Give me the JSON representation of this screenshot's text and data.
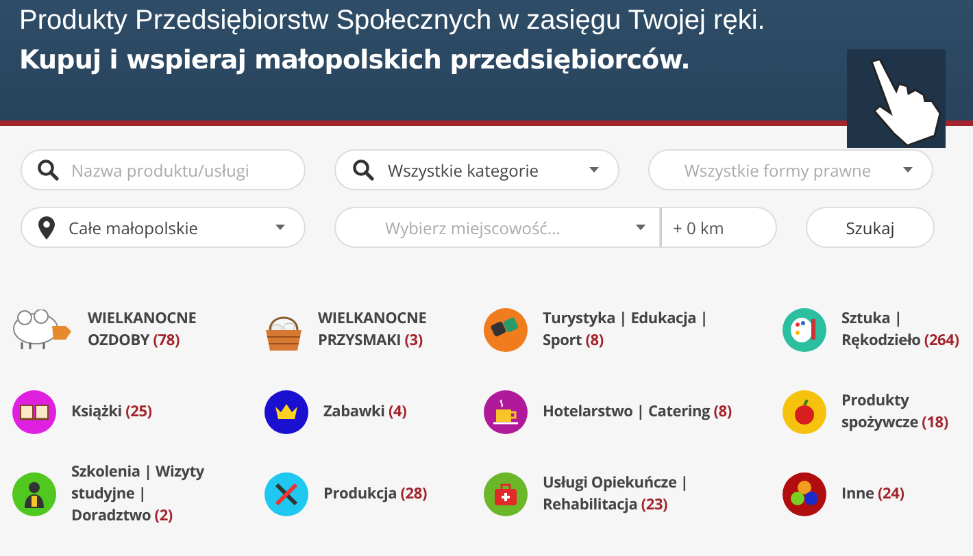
{
  "banner": {
    "line1": "Produkty Przedsiębiorstw Społecznych w zasięgu Twojej ręki.",
    "line2": "Kupuj i wspieraj małopolskich przedsiębiorców."
  },
  "filters": {
    "product": {
      "placeholder": "Nazwa produktu/usługi"
    },
    "category": {
      "value": "Wszystkie kategorie"
    },
    "legal_form": {
      "value": "Wszystkie formy prawne"
    },
    "region": {
      "value": "Całe małopolskie"
    },
    "town": {
      "placeholder": "Wybierz miejscowość..."
    },
    "distance": {
      "value": "+ 0 km"
    },
    "search_button": "Szukaj"
  },
  "categories": [
    {
      "kind": "sheep",
      "name": "WIELKANOCNE OZDOBY",
      "count": "(78)"
    },
    {
      "kind": "basket",
      "name": "WIELKANOCNE PRZYSMAKI",
      "count": "(3)"
    },
    {
      "kind": "binoculars",
      "name": "Turystyka | Edukacja | Sport",
      "count": "(8)"
    },
    {
      "kind": "palette",
      "name": "Sztuka | Rękodzieło",
      "count": "(264)"
    },
    {
      "kind": "book",
      "name": "Książki",
      "count": "(25)"
    },
    {
      "kind": "crown",
      "name": "Zabawki",
      "count": "(4)"
    },
    {
      "kind": "cup",
      "name": "Hotelarstwo | Catering",
      "count": "(8)"
    },
    {
      "kind": "apple",
      "name": "Produkty spożywcze",
      "count": "(18)"
    },
    {
      "kind": "person",
      "name": "Szkolenia | Wizyty studyjne | Doradztwo",
      "count": "(2)"
    },
    {
      "kind": "tools",
      "name": "Produkcja",
      "count": "(28)"
    },
    {
      "kind": "firstaid",
      "name": "Usługi Opiekuńcze | Rehabilitacja",
      "count": "(23)"
    },
    {
      "kind": "dots",
      "name": "Inne",
      "count": "(24)"
    }
  ]
}
